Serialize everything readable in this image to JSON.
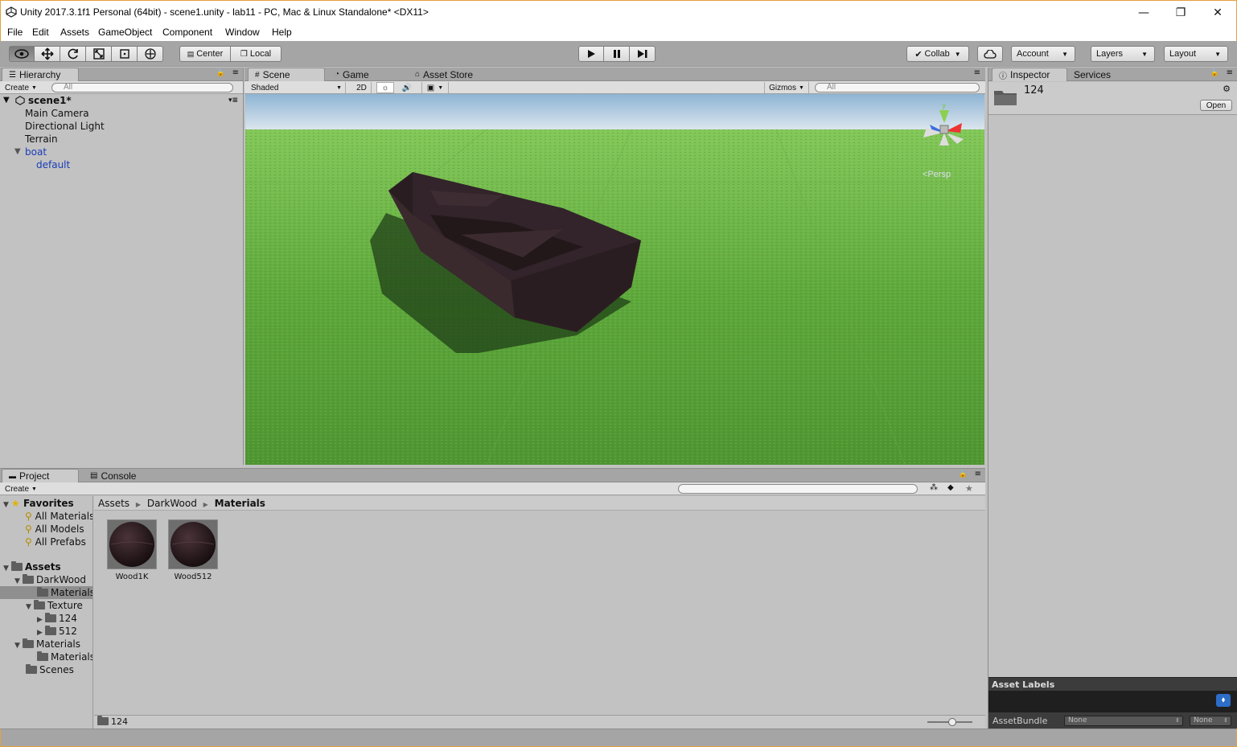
{
  "window": {
    "title": "Unity 2017.3.1f1 Personal (64bit) - scene1.unity - lab11 - PC, Mac & Linux Standalone* <DX11>",
    "minimize": "—",
    "restore": "❐",
    "close": "✕"
  },
  "menu": [
    "File",
    "Edit",
    "Assets",
    "GameObject",
    "Component",
    "Window",
    "Help"
  ],
  "toolbar": {
    "pivot": "Center",
    "space": "Local",
    "collab": "Collab",
    "account": "Account",
    "layers": "Layers",
    "layout": "Layout"
  },
  "hierarchy": {
    "tab": "Hierarchy",
    "create": "Create",
    "search_placeholder": "All",
    "scene": "scene1*",
    "items": [
      "Main Camera",
      "Directional Light",
      "Terrain",
      "boat",
      "default"
    ]
  },
  "scene_view": {
    "tabs": [
      "Scene",
      "Game",
      "Asset Store"
    ],
    "shading": "Shaded",
    "mode_2d": "2D",
    "gizmos": "Gizmos",
    "search_placeholder": "All",
    "gizmo_axis": "y",
    "projection": "Persp"
  },
  "inspector": {
    "tabs": [
      "Inspector",
      "Services"
    ],
    "asset_name": "124",
    "open_button": "Open",
    "asset_labels": "Asset Labels",
    "asset_bundle_label": "AssetBundle",
    "bundle_value": "None",
    "variant_value": "None"
  },
  "project": {
    "tabs": [
      "Project",
      "Console"
    ],
    "create": "Create",
    "favorites_header": "Favorites",
    "favorites": [
      "All Materials",
      "All Models",
      "All Prefabs"
    ],
    "assets_header": "Assets",
    "tree": [
      "DarkWood",
      "Materials",
      "Texture",
      "124",
      "512",
      "Materials",
      "Materials",
      "Scenes"
    ],
    "breadcrumb": [
      "Assets",
      "DarkWood",
      "Materials"
    ],
    "assets": [
      "Wood1K",
      "Wood512"
    ],
    "selected_path": "124"
  },
  "colors": {
    "grass": "#5ea83c",
    "sky": "#d7e4ec",
    "boat": "#2f2024",
    "selection": "#8f8f8f",
    "accent_blue": "#1a3db8"
  }
}
